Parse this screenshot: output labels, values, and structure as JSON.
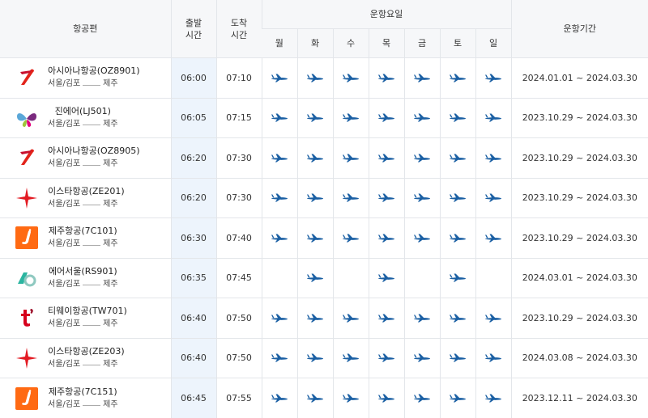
{
  "header": {
    "flight": "항공편",
    "departure": "출발\n시간",
    "arrival": "도착\n시간",
    "days_group": "운항요일",
    "days": [
      "월",
      "화",
      "수",
      "목",
      "금",
      "토",
      "일"
    ],
    "period": "운항기간"
  },
  "colors": {
    "plane": "#1a5fa3",
    "header_bg": "#f6f7f9",
    "departure_bg": "#edf4fc"
  },
  "flights": [
    {
      "logo": "asiana-logo",
      "name": "아시아나항공(OZ8901)",
      "from": "서울/김포",
      "to": "제주",
      "dep": "06:00",
      "arr": "07:10",
      "days": [
        true,
        true,
        true,
        true,
        true,
        true,
        true
      ],
      "period": "2024.01.01 ~ 2024.03.30"
    },
    {
      "logo": "jinair-logo",
      "name": "진에어(LJ501)",
      "from": "서울/김포",
      "to": "제주",
      "dep": "06:05",
      "arr": "07:15",
      "days": [
        true,
        true,
        true,
        true,
        true,
        true,
        true
      ],
      "period": "2023.10.29 ~ 2024.03.30"
    },
    {
      "logo": "asiana-logo",
      "name": "아시아나항공(OZ8905)",
      "from": "서울/김포",
      "to": "제주",
      "dep": "06:20",
      "arr": "07:30",
      "days": [
        true,
        true,
        true,
        true,
        true,
        true,
        true
      ],
      "period": "2023.10.29 ~ 2024.03.30"
    },
    {
      "logo": "eastar-logo",
      "name": "이스타항공(ZE201)",
      "from": "서울/김포",
      "to": "제주",
      "dep": "06:20",
      "arr": "07:30",
      "days": [
        true,
        true,
        true,
        true,
        true,
        true,
        true
      ],
      "period": "2023.10.29 ~ 2024.03.30"
    },
    {
      "logo": "jejuair-logo",
      "name": "제주항공(7C101)",
      "from": "서울/김포",
      "to": "제주",
      "dep": "06:30",
      "arr": "07:40",
      "days": [
        true,
        true,
        true,
        true,
        true,
        true,
        true
      ],
      "period": "2023.10.29 ~ 2024.03.30"
    },
    {
      "logo": "airseoul-logo",
      "name": "에어서울(RS901)",
      "from": "서울/김포",
      "to": "제주",
      "dep": "06:35",
      "arr": "07:45",
      "days": [
        false,
        true,
        false,
        true,
        false,
        true,
        false
      ],
      "period": "2024.03.01 ~ 2024.03.30"
    },
    {
      "logo": "tway-logo",
      "name": "티웨이항공(TW701)",
      "from": "서울/김포",
      "to": "제주",
      "dep": "06:40",
      "arr": "07:50",
      "days": [
        true,
        true,
        true,
        true,
        true,
        true,
        true
      ],
      "period": "2023.10.29 ~ 2024.03.30"
    },
    {
      "logo": "eastar-logo",
      "name": "이스타항공(ZE203)",
      "from": "서울/김포",
      "to": "제주",
      "dep": "06:40",
      "arr": "07:50",
      "days": [
        true,
        true,
        true,
        true,
        true,
        true,
        true
      ],
      "period": "2024.03.08 ~ 2024.03.30"
    },
    {
      "logo": "jejuair-logo",
      "name": "제주항공(7C151)",
      "from": "서울/김포",
      "to": "제주",
      "dep": "06:45",
      "arr": "07:55",
      "days": [
        true,
        true,
        true,
        true,
        true,
        true,
        true
      ],
      "period": "2023.12.11 ~ 2024.03.30"
    }
  ]
}
